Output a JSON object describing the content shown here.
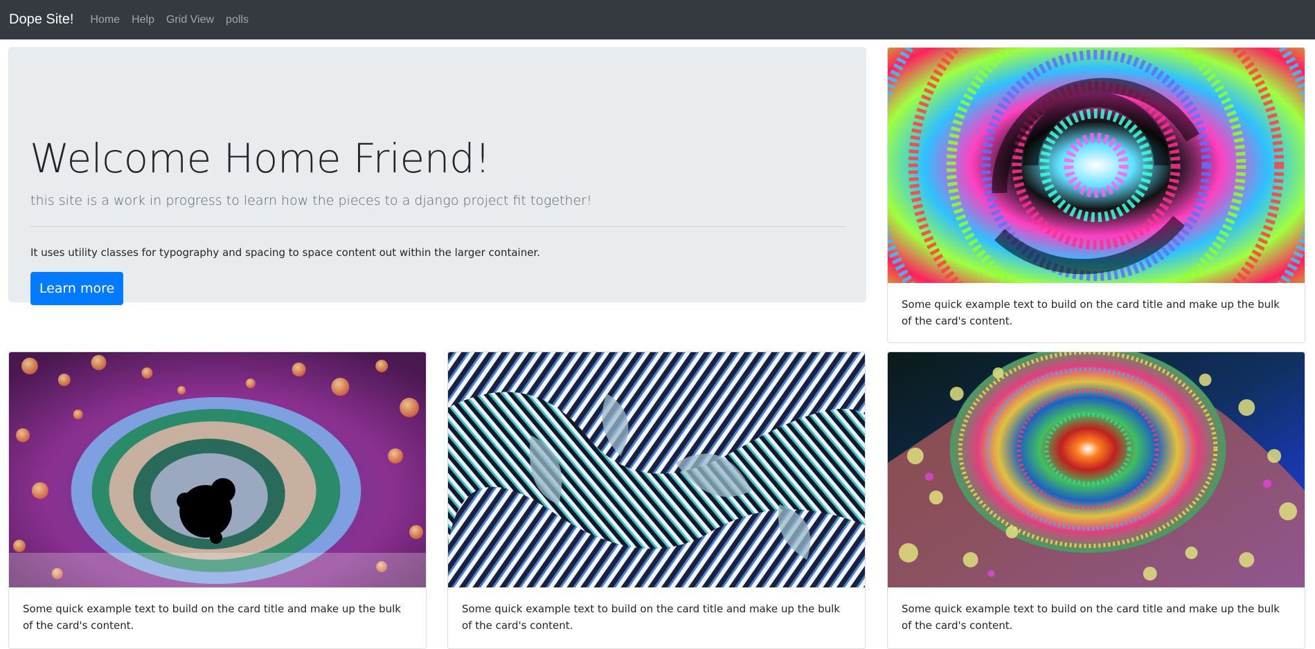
{
  "navbar": {
    "brand": "Dope Site!",
    "links": [
      "Home",
      "Help",
      "Grid View",
      "polls"
    ]
  },
  "jumbotron": {
    "title": "Welcome Home Friend!",
    "lead": "this site is a work in progress to learn how the pieces to a django project fit together!",
    "text": "It uses utility classes for typography and spacing to space content out within the larger container.",
    "button_label": "Learn more"
  },
  "cards": [
    {
      "image": "psychedelic-spiral-fractal",
      "text": "Some quick example text to build on the card title and make up the bulk of the card's content."
    },
    {
      "image": "mandelbrot-bubble-fractal",
      "text": "Some quick example text to build on the card title and make up the bulk of the card's content."
    },
    {
      "image": "striped-blue-wave-fractal",
      "text": "Some quick example text to build on the card title and make up the bulk of the card's content."
    },
    {
      "image": "rainbow-julia-fractal",
      "text": "Some quick example text to build on the card title and make up the bulk of the card's content."
    }
  ],
  "colors": {
    "navbar_bg": "#343a40",
    "jumbotron_bg": "#e9ecef",
    "primary": "#007bff"
  }
}
